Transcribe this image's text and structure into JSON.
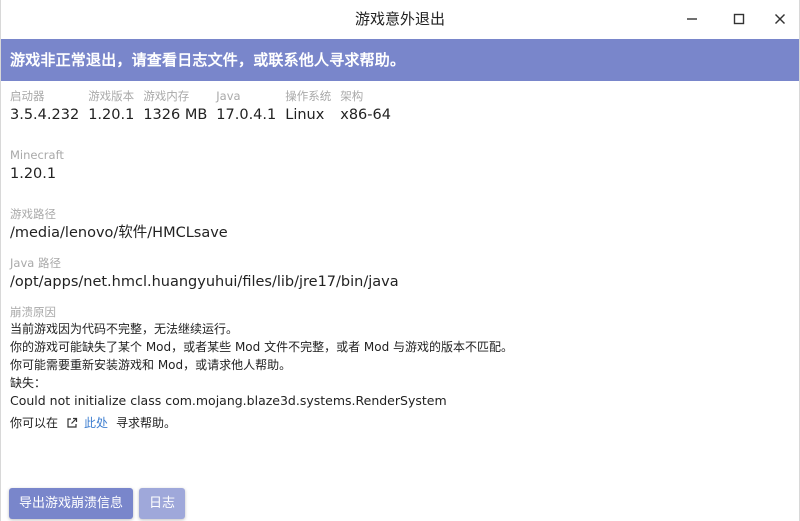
{
  "window": {
    "title": "游戏意外退出"
  },
  "banner": {
    "text": "游戏非正常退出，请查看日志文件，或联系他人寻求帮助。"
  },
  "info": [
    {
      "label": "启动器",
      "value": "3.5.4.232"
    },
    {
      "label": "游戏版本",
      "value": "1.20.1"
    },
    {
      "label": "游戏内存",
      "value": "1326 MB"
    },
    {
      "label": "Java",
      "value": "17.0.4.1"
    },
    {
      "label": "操作系统",
      "value": "Linux"
    },
    {
      "label": "架构",
      "value": "x86-64"
    }
  ],
  "minecraft": {
    "label": "Minecraft",
    "value": "1.20.1"
  },
  "game_path": {
    "label": "游戏路径",
    "value": "/media/lenovo/软件/HMCLsave"
  },
  "java_path": {
    "label": "Java 路径",
    "value": "/opt/apps/net.hmcl.huangyuhui/files/lib/jre17/bin/java"
  },
  "crash_reason": {
    "label": "崩溃原因",
    "lines": [
      "当前游戏因为代码不完整，无法继续运行。",
      "你的游戏可能缺失了某个 Mod，或者某些 Mod 文件不完整，或者 Mod 与游戏的版本不匹配。",
      "你可能需要重新安装游戏和 Mod，或请求他人帮助。",
      "缺失：",
      "Could not initialize class com.mojang.blaze3d.systems.RenderSystem"
    ]
  },
  "help": {
    "prefix": "你可以在",
    "link": "此处",
    "suffix": "寻求帮助。"
  },
  "buttons": {
    "export": "导出游戏崩溃信息",
    "log": "日志"
  },
  "colors": {
    "accent": "#7986cb",
    "accent_light": "#9fa8da",
    "link": "#3f7fd0"
  },
  "icons": {
    "minimize": "minimize-icon",
    "maximize": "maximize-icon",
    "close": "close-icon",
    "external_link": "external-link-icon"
  }
}
